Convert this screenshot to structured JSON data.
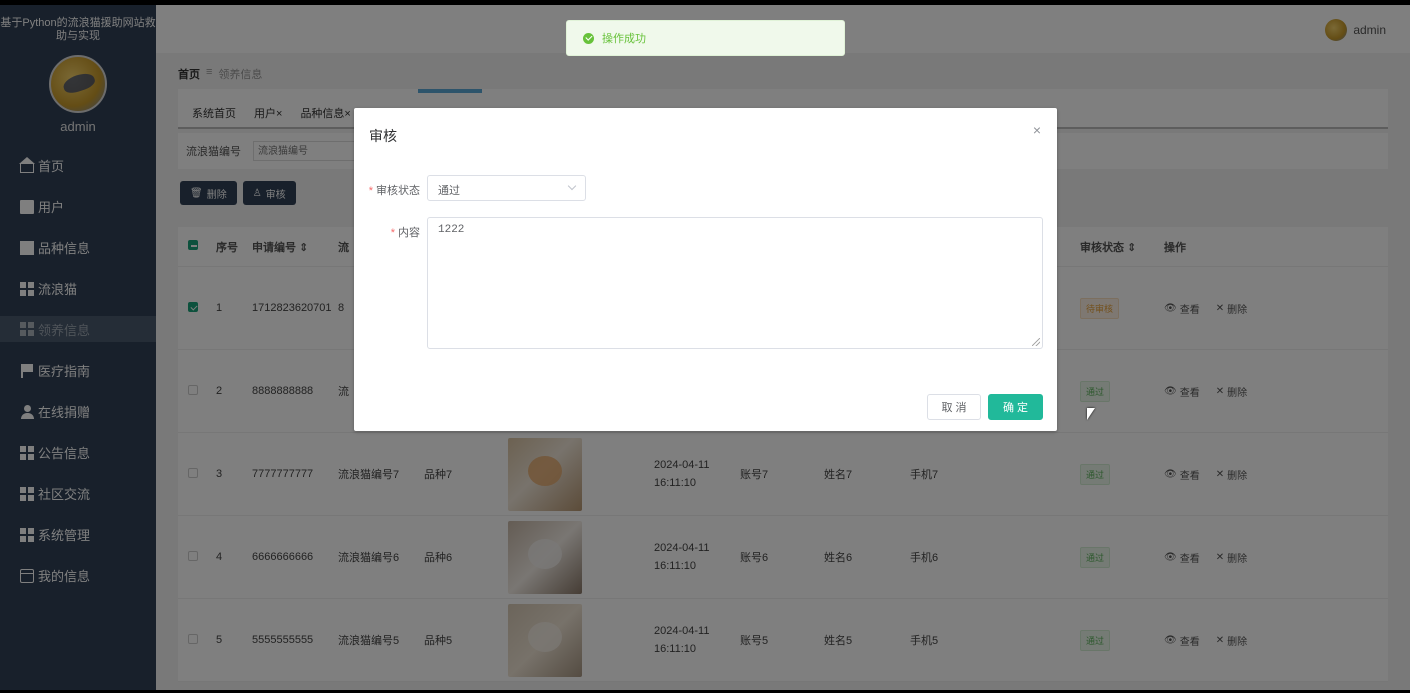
{
  "sidebar": {
    "title": "基于Python的流浪猫援助网站救助与实现",
    "username": "admin",
    "items": [
      {
        "label": "首页"
      },
      {
        "label": "用户"
      },
      {
        "label": "品种信息"
      },
      {
        "label": "流浪猫"
      },
      {
        "label": "领养信息"
      },
      {
        "label": "医疗指南"
      },
      {
        "label": "在线捐赠"
      },
      {
        "label": "公告信息"
      },
      {
        "label": "社区交流"
      },
      {
        "label": "系统管理"
      },
      {
        "label": "我的信息"
      }
    ]
  },
  "topbar": {
    "username": "admin"
  },
  "breadcrumb": {
    "home": "首页",
    "sep": "≡",
    "current": "领养信息"
  },
  "tabs": [
    {
      "label": "系统首页"
    },
    {
      "label": "用户×"
    },
    {
      "label": "品种信息×"
    }
  ],
  "search": {
    "label": "流浪猫编号",
    "placeholder": "流浪猫编号"
  },
  "buttons": {
    "delete": "删除",
    "audit": "审核"
  },
  "table": {
    "headers": {
      "no": "序号",
      "app_no": "申请编号 ⇕",
      "cat_no": "流",
      "status": "审核状态 ⇕",
      "ops": "操作"
    },
    "rows": [
      {
        "no": "1",
        "app_no": "1712823620701",
        "cat_no": "8",
        "breed": "",
        "time": "",
        "account": "",
        "name": "",
        "phone": "",
        "status": "待审核",
        "checked": true
      },
      {
        "no": "2",
        "app_no": "8888888888",
        "cat_no": "流",
        "breed": "",
        "time": "",
        "account": "",
        "name": "",
        "phone": "",
        "status": "通过",
        "checked": false
      },
      {
        "no": "3",
        "app_no": "7777777777",
        "cat_no": "流浪猫编号7",
        "breed": "品种7",
        "time": "2024-04-11 16:11:10",
        "account": "账号7",
        "name": "姓名7",
        "phone": "手机7",
        "status": "通过",
        "checked": false
      },
      {
        "no": "4",
        "app_no": "6666666666",
        "cat_no": "流浪猫编号6",
        "breed": "品种6",
        "time": "2024-04-11 16:11:10",
        "account": "账号6",
        "name": "姓名6",
        "phone": "手机6",
        "status": "通过",
        "checked": false
      },
      {
        "no": "5",
        "app_no": "5555555555",
        "cat_no": "流浪猫编号5",
        "breed": "品种5",
        "time": "2024-04-11 16:11:10",
        "account": "账号5",
        "name": "姓名5",
        "phone": "手机5",
        "status": "通过",
        "checked": false
      }
    ],
    "op_view": "查看",
    "op_delete": "删除"
  },
  "toast": {
    "message": "操作成功",
    "color": "#67c23a"
  },
  "dialog": {
    "title": "审核",
    "close": "×",
    "status_label": "审核状态",
    "status_value": "通过",
    "content_label": "内容",
    "content_value": "1222",
    "cancel": "取 消",
    "confirm": "确 定",
    "confirm_color": "#21b99a"
  }
}
